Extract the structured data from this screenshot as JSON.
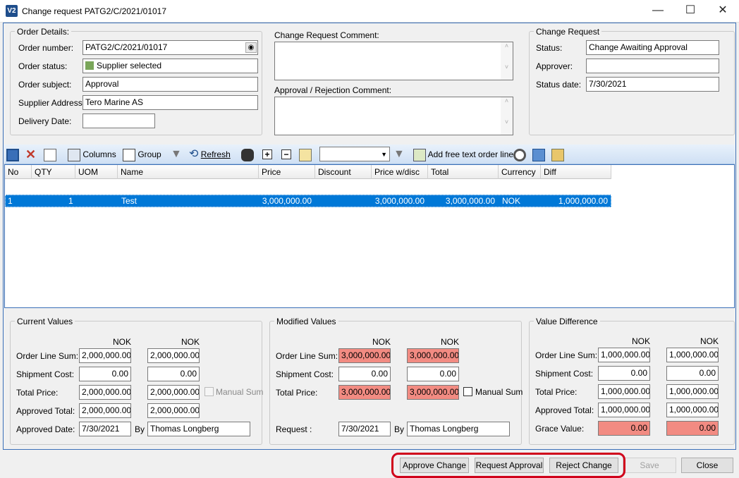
{
  "window": {
    "title": "Change request PATG2/C/2021/01017",
    "app_icon": "V2",
    "minimize": "—",
    "maximize": "☐",
    "close": "✕"
  },
  "order_details": {
    "group_label": "Order Details:",
    "order_number_label": "Order number:",
    "order_number": "PATG2/C/2021/01017",
    "order_status_label": "Order status:",
    "order_status": "Supplier selected",
    "order_subject_label": "Order subject:",
    "order_subject": "Approval",
    "supplier_address_label": "Supplier Address:",
    "supplier_address": "Tero Marine AS",
    "delivery_date_label": "Delivery Date:",
    "delivery_date": ""
  },
  "comments": {
    "change_request_label": "Change Request Comment:",
    "approval_label": "Approval / Rejection Comment:"
  },
  "change_request": {
    "group_label": "Change Request",
    "status_label": "Status:",
    "status": "Change Awaiting Approval",
    "approver_label": "Approver:",
    "approver": "",
    "status_date_label": "Status date:",
    "status_date": "7/30/2021"
  },
  "toolbar": {
    "columns": "Columns",
    "group": "Group",
    "refresh": "Refresh",
    "add_free_text": "Add free text order line",
    "combo_value": ""
  },
  "grid": {
    "columns": [
      "No",
      "QTY",
      "UOM",
      "Name",
      "Price",
      "Discount",
      "Price w/disc",
      "Total",
      "Currency",
      "Diff"
    ],
    "rows": [
      {
        "no": "1",
        "qty": "1",
        "uom": "",
        "name": "Test",
        "price": "3,000,000.00",
        "discount": "",
        "price_wdisc": "3,000,000.00",
        "total": "3,000,000.00",
        "currency": "NOK",
        "diff": "1,000,000.00"
      }
    ]
  },
  "current_values": {
    "group_label": "Current Values",
    "currency1": "NOK",
    "currency2": "NOK",
    "order_line_sum_label": "Order Line Sum:",
    "order_line_sum": [
      "2,000,000.00",
      "2,000,000.00"
    ],
    "shipment_cost_label": "Shipment Cost:",
    "shipment_cost": [
      "0.00",
      "0.00"
    ],
    "total_price_label": "Total Price:",
    "total_price": [
      "2,000,000.00",
      "2,000,000.00"
    ],
    "manual_sum_label": "Manual Sum",
    "approved_total_label": "Approved Total:",
    "approved_total": [
      "2,000,000.00",
      "2,000,000.00"
    ],
    "approved_date_label": "Approved Date:",
    "approved_date": "7/30/2021",
    "by_label": "By",
    "by": "Thomas Longberg"
  },
  "modified_values": {
    "group_label": "Modified Values",
    "currency1": "NOK",
    "currency2": "NOK",
    "order_line_sum_label": "Order Line Sum:",
    "order_line_sum": [
      "3,000,000.00",
      "3,000,000.00"
    ],
    "shipment_cost_label": "Shipment Cost:",
    "shipment_cost": [
      "0.00",
      "0.00"
    ],
    "total_price_label": "Total Price:",
    "total_price": [
      "3,000,000.00",
      "3,000,000.00"
    ],
    "manual_sum_label": "Manual Sum",
    "request_label": "Request :",
    "request_date": "7/30/2021",
    "by_label": "By",
    "by": "Thomas Longberg"
  },
  "value_difference": {
    "group_label": "Value Difference",
    "currency1": "NOK",
    "currency2": "NOK",
    "order_line_sum_label": "Order Line Sum:",
    "order_line_sum": [
      "1,000,000.00",
      "1,000,000.00"
    ],
    "shipment_cost_label": "Shipment Cost:",
    "shipment_cost": [
      "0.00",
      "0.00"
    ],
    "total_price_label": "Total Price:",
    "total_price": [
      "1,000,000.00",
      "1,000,000.00"
    ],
    "approved_total_label": "Approved Total:",
    "approved_total": [
      "1,000,000.00",
      "1,000,000.00"
    ],
    "grace_value_label": "Grace Value:",
    "grace_value": [
      "0.00",
      "0.00"
    ]
  },
  "buttons": {
    "approve": "Approve Change",
    "request": "Request Approval",
    "reject": "Reject Change",
    "save": "Save",
    "close": "Close"
  },
  "colors": {
    "accent": "#3a6fb8",
    "selection": "#0078d7",
    "highlight_value": "#f28b82",
    "annotation": "#d0021b"
  }
}
